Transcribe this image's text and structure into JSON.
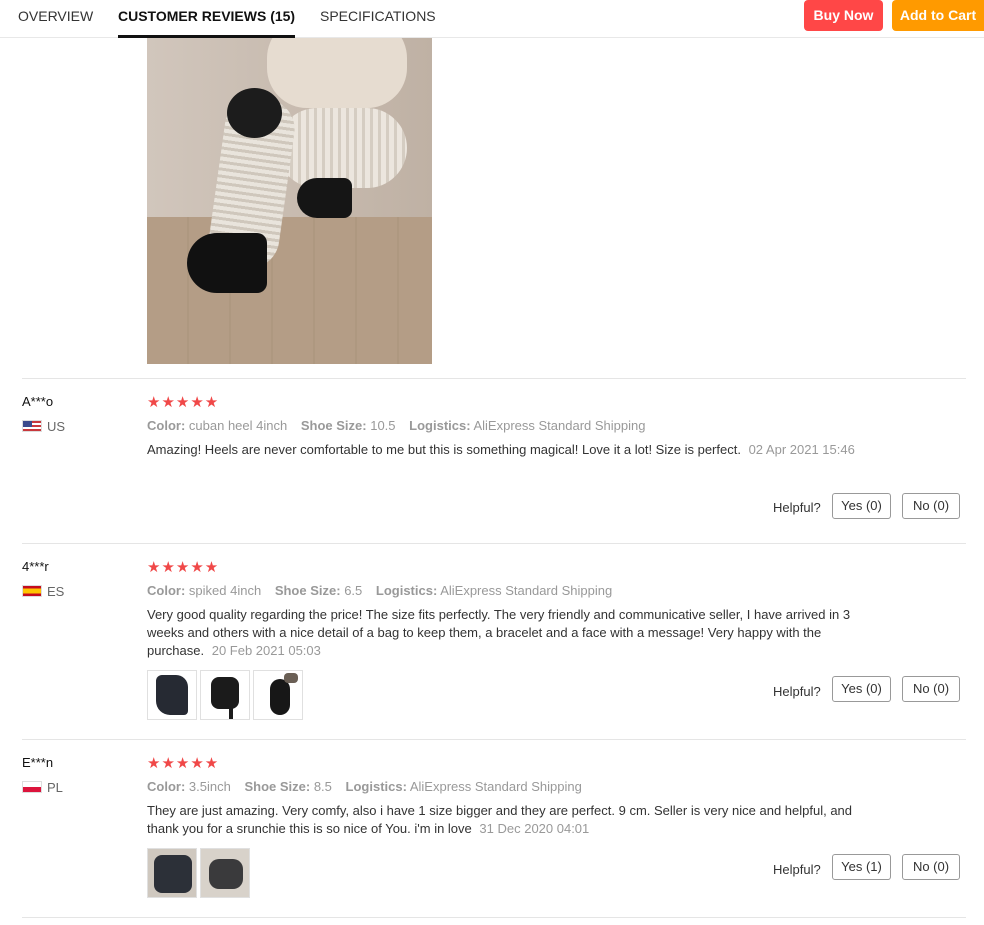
{
  "nav": {
    "tabs": [
      {
        "label": "OVERVIEW"
      },
      {
        "label": "CUSTOMER REVIEWS (15)"
      },
      {
        "label": "SPECIFICATIONS"
      }
    ],
    "buy_now": "Buy Now",
    "add_to_cart": "Add to Cart"
  },
  "colors": {
    "buy_now": "#ff4747",
    "add_to_cart": "#ff9a00",
    "stars": "#f04848"
  },
  "reviews": [
    {
      "user": "A***o",
      "country": "US",
      "stars": "★★★★★",
      "color_label": "Color:",
      "color": "cuban heel 4inch",
      "size_label": "Shoe Size:",
      "size": "10.5",
      "logistics_label": "Logistics:",
      "logistics": "AliExpress Standard Shipping",
      "text": "Amazing! Heels are never comfortable to me but this is something magical! Love it a lot! Size is perfect.",
      "date": "02 Apr 2021 15:46",
      "helpful": "Helpful?",
      "yes": "Yes (0)",
      "no": "No (0)"
    },
    {
      "user": "4***r",
      "country": "ES",
      "stars": "★★★★★",
      "color_label": "Color:",
      "color": "spiked 4inch",
      "size_label": "Shoe Size:",
      "size": "6.5",
      "logistics_label": "Logistics:",
      "logistics": "AliExpress Standard Shipping",
      "text": "Very good quality regarding the price! The size fits perfectly. The very friendly and communicative seller, I have arrived in 3 weeks and others with a nice detail of a bag to keep them, a bracelet and a face with a message! Very happy with the purchase.",
      "date": "20 Feb 2021 05:03",
      "helpful": "Helpful?",
      "yes": "Yes (0)",
      "no": "No (0)"
    },
    {
      "user": "E***n",
      "country": "PL",
      "stars": "★★★★★",
      "color_label": "Color:",
      "color": "3.5inch",
      "size_label": "Shoe Size:",
      "size": "8.5",
      "logistics_label": "Logistics:",
      "logistics": "AliExpress Standard Shipping",
      "text": "They are just amazing. Very comfy, also i have 1 size bigger and they are perfect. 9 cm. Seller is very nice and helpful, and thank you for a srunchie this is so nice of You. i'm in love",
      "date": "31 Dec 2020 04:01",
      "helpful": "Helpful?",
      "yes": "Yes (1)",
      "no": "No (0)"
    }
  ]
}
